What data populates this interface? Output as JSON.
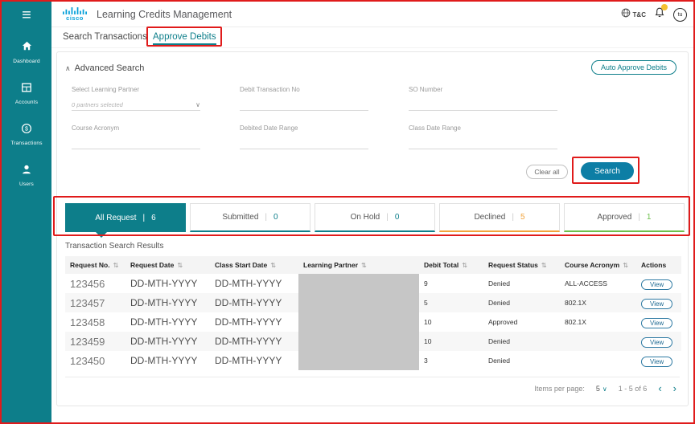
{
  "colors": {
    "accent": "#0d7e8a",
    "search": "#0d7ea5",
    "annotation": "#e01b1b",
    "declined": "#f2a33c",
    "approved": "#6cbf4b",
    "redaction": "#c6c6c6",
    "badge": "#f5c231"
  },
  "icons": {
    "menu": "≡",
    "collapse": "∧",
    "chevron_down": "∨",
    "sort": "⇅",
    "prev": "‹",
    "next": "›",
    "divider": "|"
  },
  "sidebar": {
    "items": [
      {
        "label": "Dashboard"
      },
      {
        "label": "Accounts"
      },
      {
        "label": "Transactions"
      },
      {
        "label": "Users"
      }
    ]
  },
  "header": {
    "brand": "cisco",
    "title": "Learning Credits Management",
    "tc_label": "T&C",
    "avatar_initials": "tu"
  },
  "page_tabs": [
    {
      "label": "Search Transactions"
    },
    {
      "label": "Approve Debits"
    }
  ],
  "advanced_search": {
    "title": "Advanced Search",
    "auto_approve_button": "Auto Approve Debits",
    "fields": [
      {
        "label": "Select Learning Partner",
        "value": "0 partners selected"
      },
      {
        "label": "Debit Transaction No",
        "value": ""
      },
      {
        "label": "SO Number",
        "value": ""
      },
      {
        "label": "Course Acronym",
        "value": ""
      },
      {
        "label": "Debited Date Range",
        "value": ""
      },
      {
        "label": "Class Date Range",
        "value": ""
      }
    ],
    "clear_button": "Clear all",
    "search_button": "Search"
  },
  "status_tabs": [
    {
      "label": "All Request",
      "count": "6"
    },
    {
      "label": "Submitted",
      "count": "0"
    },
    {
      "label": "On Hold",
      "count": "0"
    },
    {
      "label": "Declined",
      "count": "5"
    },
    {
      "label": "Approved",
      "count": "1"
    }
  ],
  "results": {
    "title": "Transaction Search Results",
    "columns": [
      {
        "label": "Request No."
      },
      {
        "label": "Request Date"
      },
      {
        "label": "Class Start Date"
      },
      {
        "label": "Learning Partner"
      },
      {
        "label": "Debit Total"
      },
      {
        "label": "Request Status"
      },
      {
        "label": "Course Acronym"
      },
      {
        "label": "Actions"
      }
    ],
    "rows": [
      {
        "request_no": "123456",
        "request_date": "DD-MTH-YYYY",
        "class_start_date": "DD-MTH-YYYY",
        "learning_partner": "",
        "debit_total": "9",
        "request_status": "Denied",
        "course_acronym": "ALL-ACCESS",
        "action": "View"
      },
      {
        "request_no": "123457",
        "request_date": "DD-MTH-YYYY",
        "class_start_date": "DD-MTH-YYYY",
        "learning_partner": "",
        "debit_total": "5",
        "request_status": "Denied",
        "course_acronym": "802.1X",
        "action": "View"
      },
      {
        "request_no": "123458",
        "request_date": "DD-MTH-YYYY",
        "class_start_date": "DD-MTH-YYYY",
        "learning_partner": "",
        "debit_total": "10",
        "request_status": "Approved",
        "course_acronym": "802.1X",
        "action": "View"
      },
      {
        "request_no": "123459",
        "request_date": "DD-MTH-YYYY",
        "class_start_date": "DD-MTH-YYYY",
        "learning_partner": "",
        "debit_total": "10",
        "request_status": "Denied",
        "course_acronym": "",
        "action": "View"
      },
      {
        "request_no": "123450",
        "request_date": "DD-MTH-YYYY",
        "class_start_date": "DD-MTH-YYYY",
        "learning_partner": "",
        "debit_total": "3",
        "request_status": "Denied",
        "course_acronym": "",
        "action": "View"
      }
    ],
    "pagination": {
      "items_per_page_label": "Items per page:",
      "items_per_page_value": "5",
      "range": "1 - 5 of 6"
    }
  }
}
